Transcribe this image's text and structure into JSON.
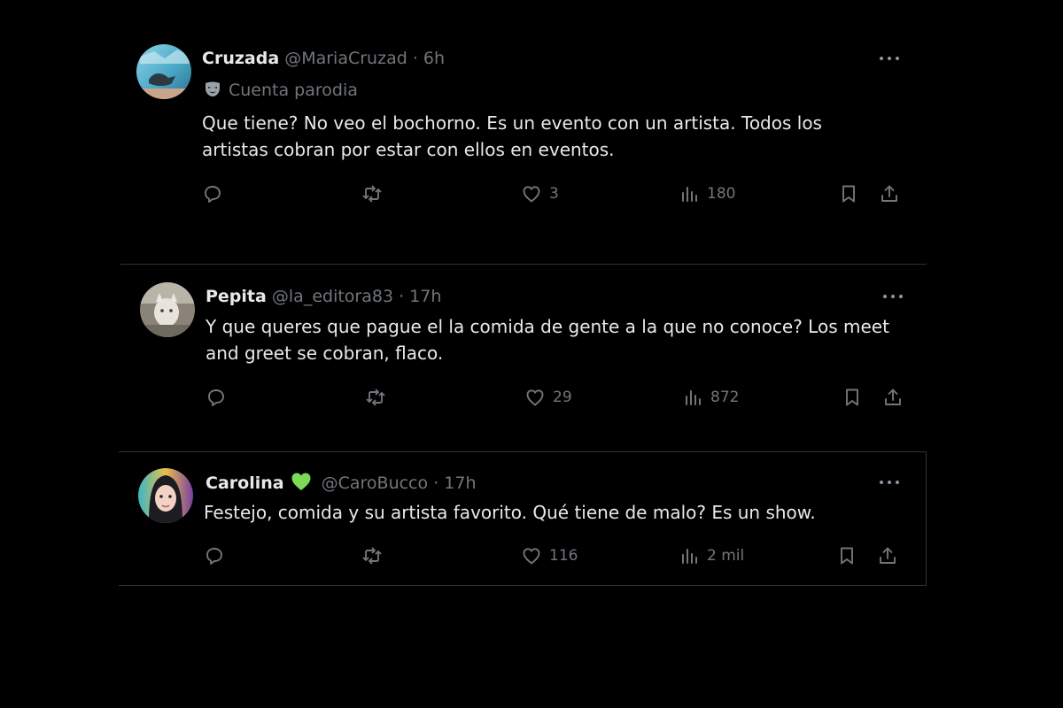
{
  "tweets": [
    {
      "name": "Cruzada",
      "handle": "@MariaCruzad",
      "separator": "·",
      "time": "6h",
      "parody_label": "Cuenta parodia",
      "text": "Que tiene? No veo el bochorno. Es un evento con un artista. Todos los artistas cobran por estar con ellos en eventos.",
      "likes": "3",
      "views": "180"
    },
    {
      "name": "Pepita",
      "handle": "@la_editora83",
      "separator": "·",
      "time": "17h",
      "text": "Y que queres que pague el la comida de gente a la que no conoce? Los meet and greet se cobran, flaco.",
      "likes": "29",
      "views": "872"
    },
    {
      "name": "Carolina",
      "handle": "@CaroBucco",
      "separator": "·",
      "time": "17h",
      "name_badge_icon": "green-heart-icon",
      "text": "Festejo, comida y su artista favorito. Qué tiene de malo? Es un show.",
      "likes": "116",
      "views": "2 mil"
    }
  ],
  "icons": {
    "reply": "reply-icon",
    "repost": "repost-icon",
    "like": "like-icon",
    "views": "views-icon",
    "bookmark": "bookmark-icon",
    "share": "share-icon",
    "more": "more-icon",
    "parody": "parody-mask-icon"
  },
  "colors": {
    "background": "#000000",
    "text_primary": "#e7e9ea",
    "text_secondary": "#71767b",
    "divider": "#2f3336",
    "badge_green": "#7ed957"
  }
}
